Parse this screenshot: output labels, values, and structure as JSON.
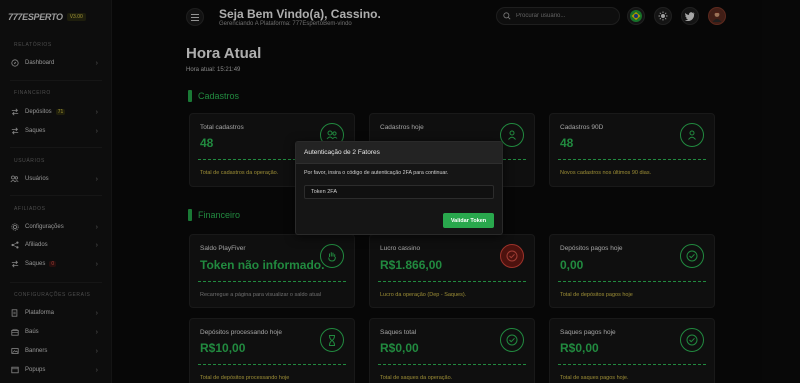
{
  "brand": {
    "logo": "777ESPERTO",
    "badge": "V3.00"
  },
  "sidebar": {
    "sections": [
      {
        "title": "RELATÓRIOS"
      },
      {
        "title": "FINANCEIRO"
      },
      {
        "title": "USUÁRIOS"
      },
      {
        "title": "AFILIADOS"
      },
      {
        "title": "CONFIGURAÇÕES GERAIS"
      }
    ],
    "items": [
      {
        "label": "Dashboard"
      },
      {
        "label": "Depósitos",
        "count": "71"
      },
      {
        "label": "Saques"
      },
      {
        "label": "Usuários"
      },
      {
        "label": "Configurações"
      },
      {
        "label": "Afiliados"
      },
      {
        "label": "Saques",
        "count": "0"
      },
      {
        "label": "Plataforma"
      },
      {
        "label": "Baús"
      },
      {
        "label": "Banners"
      },
      {
        "label": "Popups"
      }
    ]
  },
  "header": {
    "welcome": "Seja Bem Vindo(a), Cassino.",
    "subtitle": "Gerenciando A Plataforma: 777EspertoBem-vindo",
    "search_placeholder": "Procurar usuário..."
  },
  "main": {
    "title": "Hora Atual",
    "time": "Hora atual: 15:21:49",
    "sections": {
      "cadastros": "Cadastros",
      "financeiro": "Financeiro"
    },
    "cards": [
      {
        "label": "Total cadastros",
        "value": "48",
        "footer": "Total de cadastros da operação."
      },
      {
        "label": "Cadastros hoje",
        "value": "",
        "footer": ""
      },
      {
        "label": "Cadastros 90D",
        "value": "48",
        "footer": "Novos cadastros nos últimos 90 dias."
      },
      {
        "label": "Saldo PlayFiver",
        "value": "Token não informado.",
        "footer": "Recarregue a página para visualizar o saldo atual"
      },
      {
        "label": "Lucro cassino",
        "value": "R$1.866,00",
        "footer": "Lucro da operação (Dep - Saques)."
      },
      {
        "label": "Depósitos pagos hoje",
        "value": "0,00",
        "footer": "Total de depósitos pagos hoje"
      },
      {
        "label": "Depósitos processando hoje",
        "value": "R$10,00",
        "footer": "Total de depósitos processando hoje"
      },
      {
        "label": "Saques total",
        "value": "R$0,00",
        "footer": "Total de saques da operação."
      },
      {
        "label": "Saques pagos hoje",
        "value": "R$0,00",
        "footer": "Total de saques pagos hoje."
      }
    ]
  },
  "modal": {
    "title": "Autenticação de 2 Fatores",
    "description": "Por favor, insira o código de autenticação 2FA para continuar.",
    "input_placeholder": "Token 2FA",
    "button": "Validar Token"
  },
  "colors": {
    "accent": "#2fbf58",
    "footer_text": "#d6c24a",
    "danger": "#d9463b",
    "background": "#0b0b0b"
  }
}
